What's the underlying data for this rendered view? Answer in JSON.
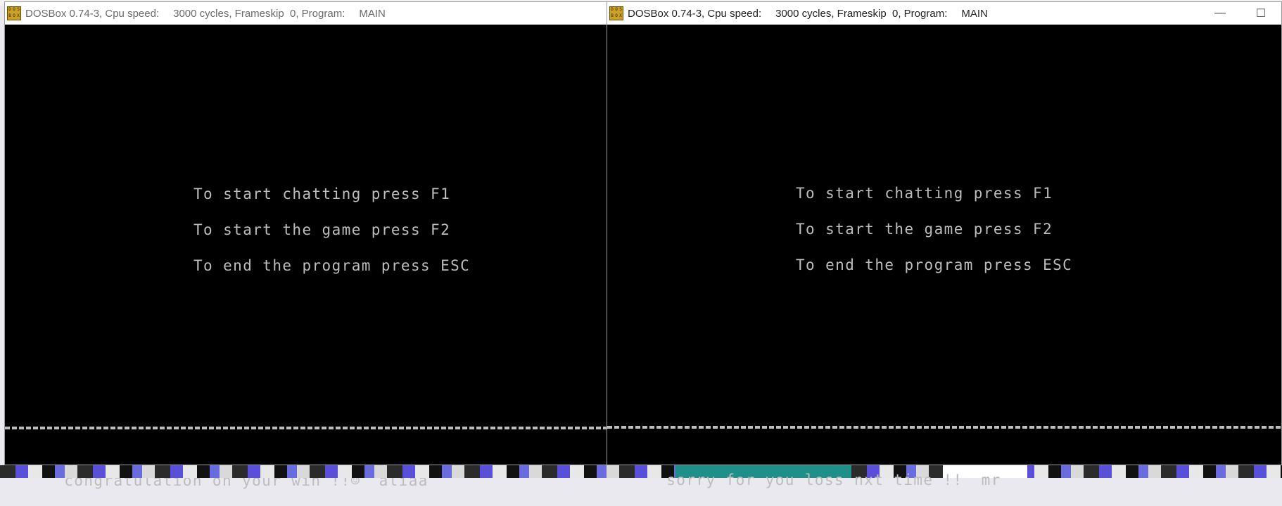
{
  "windows": [
    {
      "id": "left",
      "title": {
        "app": "DOSBox 0.74-3, Cpu speed:",
        "cycles": "3000 cycles, Frameskip  0, Program:",
        "program": "MAIN"
      },
      "menu": [
        "To start chatting press F1",
        "To start the game press F2",
        "To end the program press ESC"
      ],
      "status": {
        "message": "congratulation on your win !!☺",
        "name": "aliaa"
      }
    },
    {
      "id": "right",
      "title": {
        "app": "DOSBox 0.74-3, Cpu speed:",
        "cycles": "3000 cycles, Frameskip  0, Program:",
        "program": "MAIN"
      },
      "menu": [
        "To start chatting press F1",
        "To start the game press F2",
        "To end the program press ESC"
      ],
      "status": {
        "message": "sorry for you loss nxt time !!",
        "name": "mr"
      },
      "controls": {
        "minimize": "—",
        "maximize": "☐"
      }
    }
  ],
  "icons": {
    "app": "dosbox-icon"
  }
}
